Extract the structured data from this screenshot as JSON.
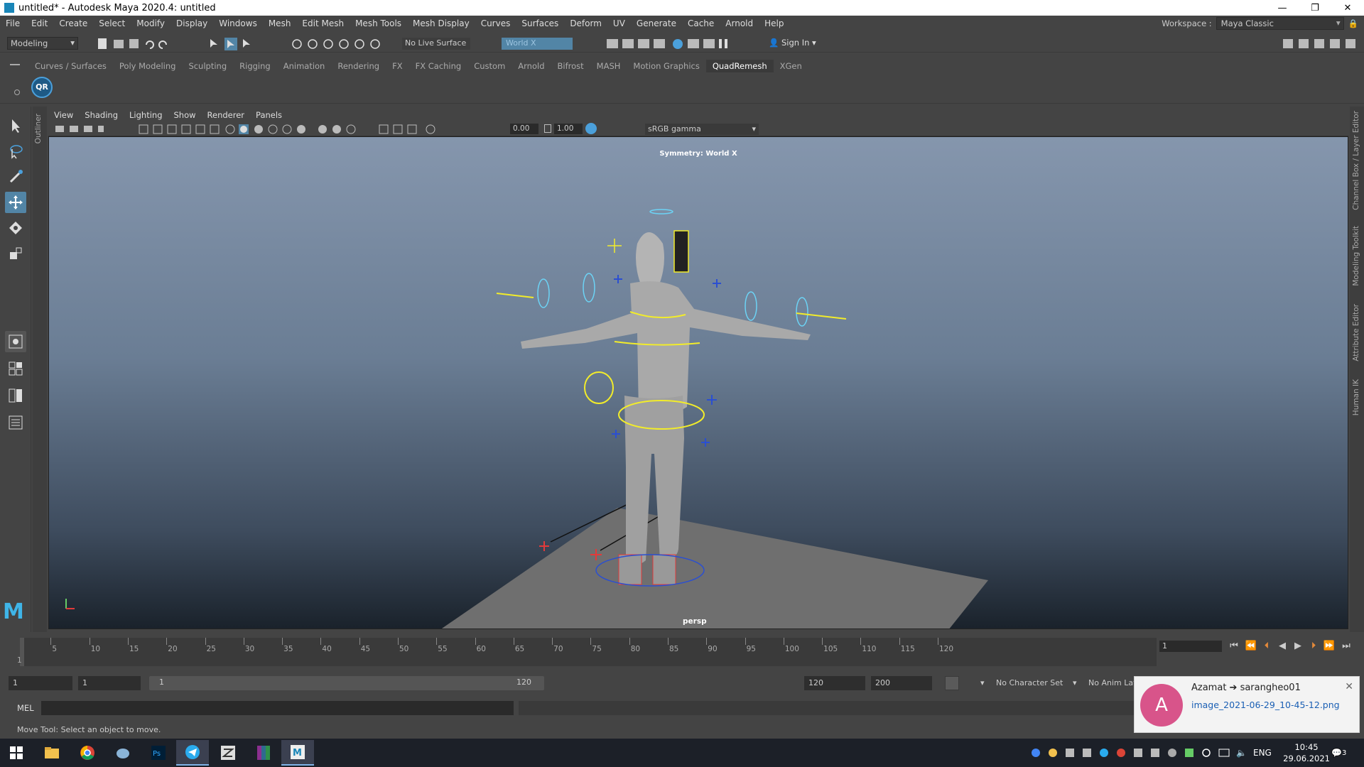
{
  "window": {
    "title": "untitled* - Autodesk Maya 2020.4: untitled",
    "min": "—",
    "max": "❐",
    "close": "✕"
  },
  "menu": [
    "File",
    "Edit",
    "Create",
    "Select",
    "Modify",
    "Display",
    "Windows",
    "Mesh",
    "Edit Mesh",
    "Mesh Tools",
    "Mesh Display",
    "Curves",
    "Surfaces",
    "Deform",
    "UV",
    "Generate",
    "Cache",
    "Arnold",
    "Help"
  ],
  "workspace": {
    "label": "Workspace :",
    "value": "Maya Classic"
  },
  "statusline": {
    "mode": "Modeling",
    "live_surface": "No Live Surface",
    "symmetry": "World X",
    "sign_in": "Sign In"
  },
  "shelf": {
    "tabs": [
      "Curves / Surfaces",
      "Poly Modeling",
      "Sculpting",
      "Rigging",
      "Animation",
      "Rendering",
      "FX",
      "FX Caching",
      "Custom",
      "Arnold",
      "Bifrost",
      "MASH",
      "Motion Graphics",
      "QuadRemesh",
      "XGen"
    ],
    "active": "QuadRemesh",
    "qr_label": "QR"
  },
  "outliner_tab": "Outliner",
  "viewport": {
    "menu": [
      "View",
      "Shading",
      "Lighting",
      "Show",
      "Renderer",
      "Panels"
    ],
    "exposure": "0.00",
    "gamma": "1.00",
    "colorspace": "sRGB gamma",
    "symmetry_label": "Symmetry: World X",
    "camera": "persp"
  },
  "right_tabs": [
    "Channel Box / Layer Editor",
    "Modeling Toolkit",
    "Attribute Editor",
    "Human IK"
  ],
  "timeline": {
    "ticks": [
      5,
      10,
      15,
      20,
      25,
      30,
      35,
      40,
      45,
      50,
      55,
      60,
      65,
      70,
      75,
      80,
      85,
      90,
      95,
      100,
      105,
      110,
      115,
      120
    ],
    "start_label": "1",
    "current_frame": "1"
  },
  "range": {
    "start": "1",
    "anim_start": "1",
    "slider_start": "1",
    "slider_end": "120",
    "anim_end": "120",
    "end": "200",
    "character_set": "No Character Set",
    "anim_layer": "No Anim Layer"
  },
  "mel": {
    "label": "MEL"
  },
  "help_line": "Move Tool: Select an object to move.",
  "notification": {
    "avatar_letter": "A",
    "title": "Azamat ➔ sarangheo01",
    "link": "image_2021-06-29_10-45-12.png",
    "close": "✕"
  },
  "taskbar": {
    "lang": "ENG",
    "time": "10:45",
    "date": "29.06.2021",
    "notif_count": "3"
  }
}
